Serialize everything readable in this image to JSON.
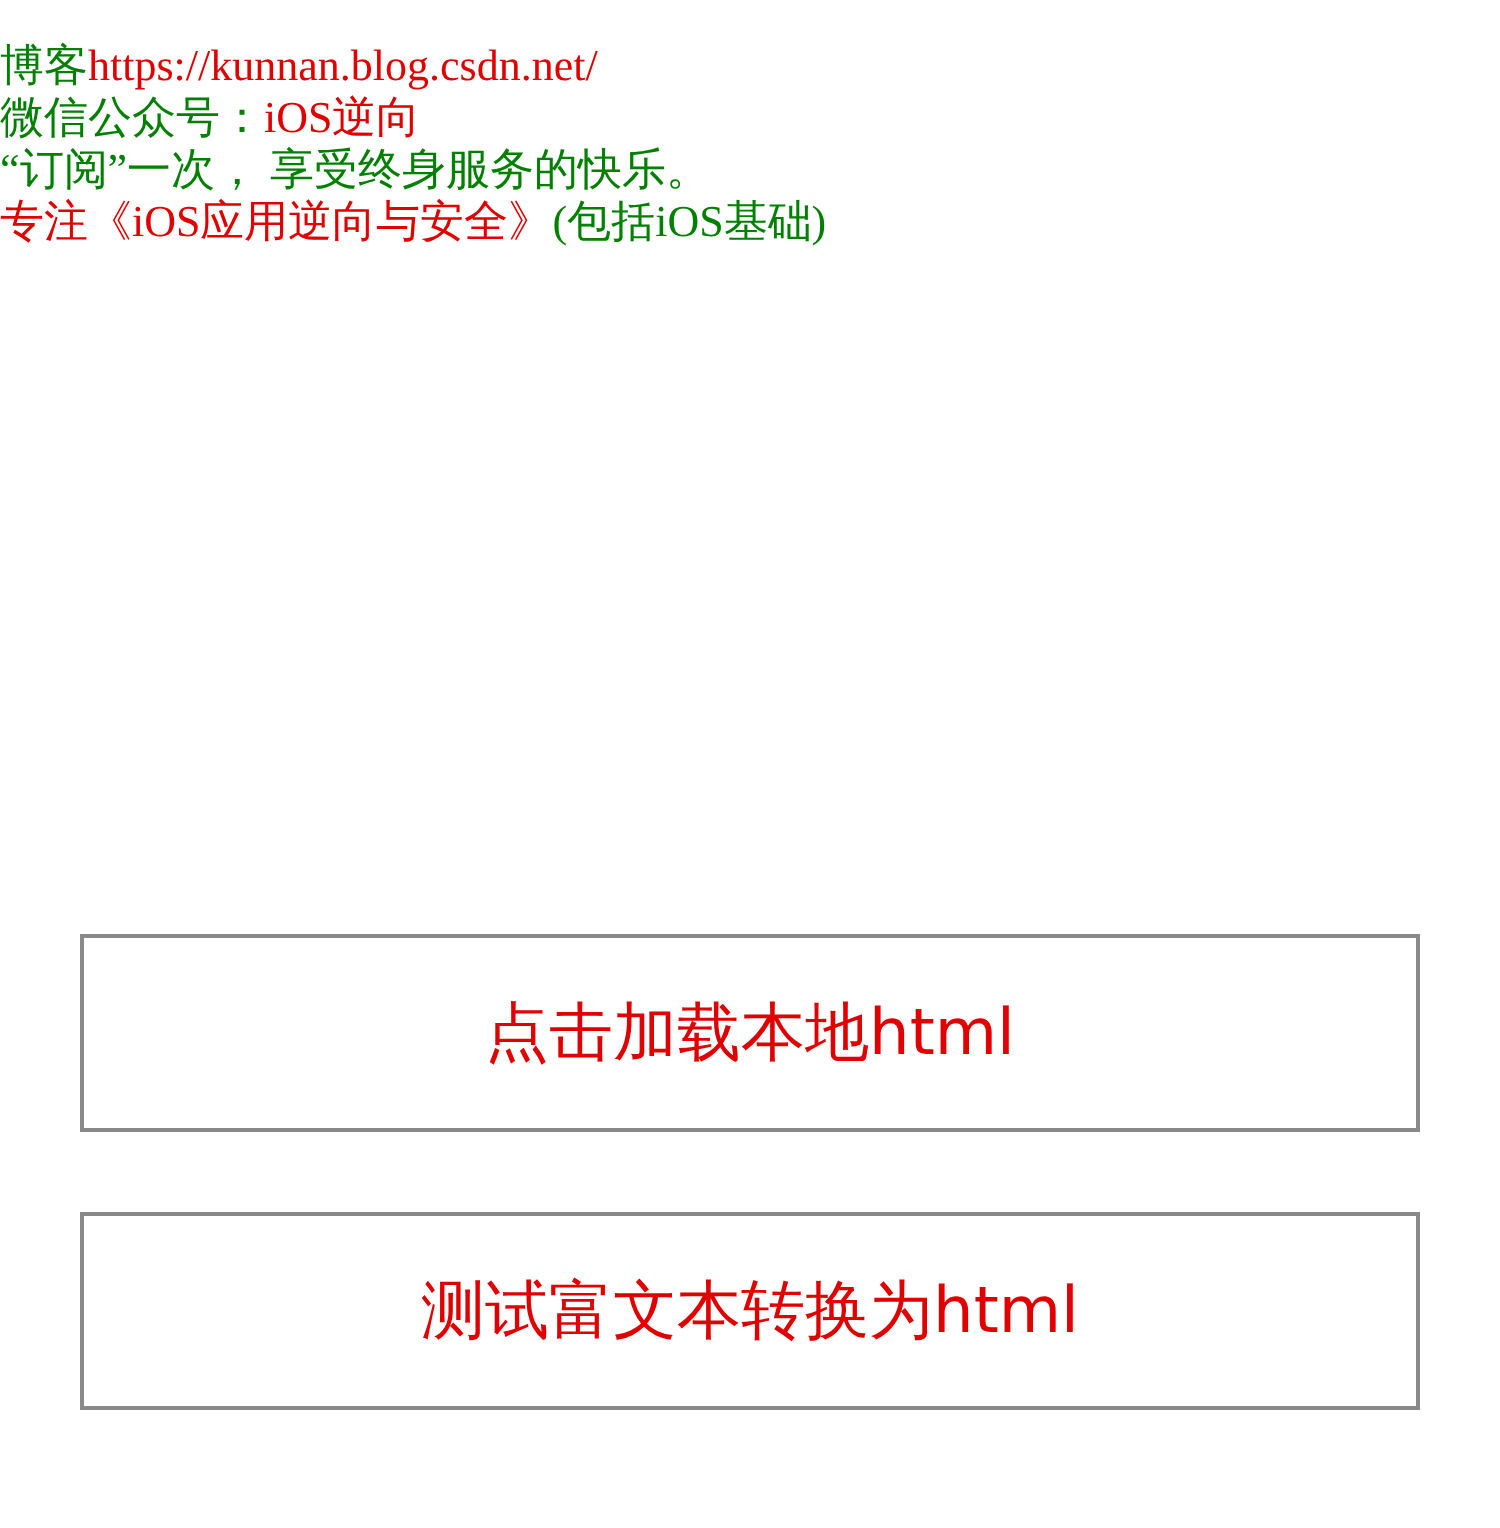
{
  "intro_lines": [
    {
      "segments": [
        {
          "text": "博客",
          "color": "#008000"
        },
        {
          "text": "https://kunnan.blog.csdn.net/",
          "color": "#e00000"
        }
      ]
    },
    {
      "segments": [
        {
          "text": "微信公众号：",
          "color": "#008000"
        },
        {
          "text": "iOS逆向",
          "color": "#e00000"
        }
      ]
    },
    {
      "segments": [
        {
          "text": "“订阅”一次， 享受终身服务的快乐。",
          "color": "#008000"
        }
      ]
    },
    {
      "segments": [
        {
          "text": "专注《iOS应用逆向与安全》",
          "color": "#e00000"
        },
        {
          "text": "(包括iOS基础)",
          "color": "#008000"
        }
      ]
    }
  ],
  "buttons": [
    {
      "label": "点击加载本地html"
    },
    {
      "label": "测试富文本转换为html"
    }
  ]
}
